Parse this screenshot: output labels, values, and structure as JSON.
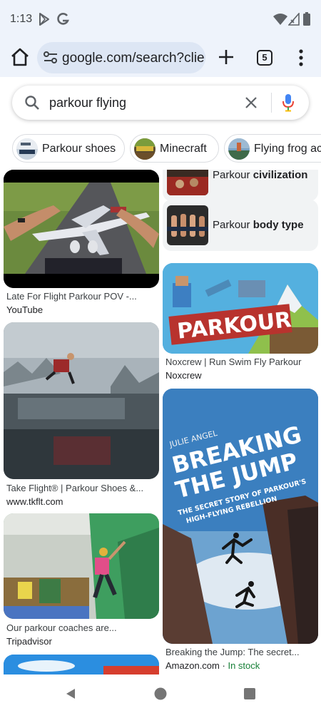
{
  "status_bar": {
    "time": "1:13"
  },
  "browser": {
    "url": "google.com/search?client=ms-android-google",
    "tab_count": "5"
  },
  "search": {
    "query": "parkour flying"
  },
  "chips": [
    {
      "label": "Parkour shoes"
    },
    {
      "label": "Minecraft"
    },
    {
      "label": "Flying frog ac"
    }
  ],
  "results": {
    "left": [
      {
        "title": "Late For Flight Parkour POV -...",
        "source": "YouTube"
      },
      {
        "title": "Take Flight® | Parkour Shoes &...",
        "source": "www.tkflt.com"
      },
      {
        "title": "Our parkour coaches are...",
        "source": "Tripadvisor"
      }
    ],
    "right": [
      {
        "title": "Noxcrew | Run Swim Fly Parkour",
        "source": "Noxcrew"
      },
      {
        "title": "Breaking the Jump: The secret...",
        "source": "Amazon.com",
        "separator": "·",
        "availability": "In stock"
      }
    ],
    "related": [
      {
        "prefix": "Parkour ",
        "bold": "civilization"
      },
      {
        "prefix": "Parkour ",
        "bold": "body type"
      }
    ],
    "book_cover": {
      "author": "JULIE ANGEL",
      "line1": "BREAKING",
      "line2": "THE JUMP",
      "subtitle1": "THE SECRET STORY OF PARKOUR'S",
      "subtitle2": "HIGH-FLYING REBELLION"
    },
    "game_logo": "PARKOUR"
  },
  "colors": {
    "chrome_bg": "#eef3fb",
    "url_pill": "#dde6f4",
    "link_green": "#188038",
    "mic_blue": "#4285f4",
    "mic_red": "#ea4335"
  },
  "icons": [
    "home-icon",
    "tune-icon",
    "plus-icon",
    "tab-switcher-icon",
    "more-vert-icon",
    "search-icon",
    "close-icon",
    "mic-icon",
    "back-icon",
    "home-nav-icon",
    "recents-icon"
  ]
}
